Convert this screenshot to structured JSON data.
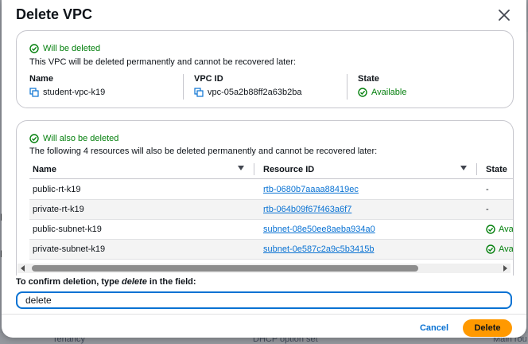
{
  "background": {
    "side_labels": [
      "P",
      "P"
    ],
    "bottom_labels": [
      "Tenancy",
      "DHCP option set",
      "Main rou"
    ]
  },
  "modal": {
    "title": "Delete VPC",
    "vpc_panel": {
      "status": "Will be deleted",
      "description": "This VPC will be deleted permanently and cannot be recovered later:",
      "name_label": "Name",
      "name_value": "student-vpc-k19",
      "id_label": "VPC ID",
      "id_value": "vpc-05a2b88ff2a63b2ba",
      "state_label": "State",
      "state_value": "Available"
    },
    "resources_panel": {
      "status": "Will also be deleted",
      "description": "The following 4 resources will also be deleted permanently and cannot be recovered later:",
      "columns": [
        "Name",
        "Resource ID",
        "State"
      ],
      "rows": [
        {
          "name": "public-rt-k19",
          "id": "rtb-0680b7aaaa88419ec",
          "state": "-"
        },
        {
          "name": "private-rt-k19",
          "id": "rtb-064b09f67f463a6f7",
          "state": "-"
        },
        {
          "name": "public-subnet-k19",
          "id": "subnet-08e50ee8aeba934a0",
          "state": "Ava"
        },
        {
          "name": "private-subnet-k19",
          "id": "subnet-0e587c2a9c5b3415b",
          "state": "Ava"
        }
      ]
    },
    "confirm_label_prefix": "To confirm deletion, type ",
    "confirm_label_word": "delete",
    "confirm_label_suffix": " in the field:",
    "confirm_value": "delete",
    "cancel_label": "Cancel",
    "delete_label": "Delete"
  },
  "colors": {
    "success": "#037f0c",
    "link": "#0972d3",
    "primary_button": "#ff9900"
  }
}
